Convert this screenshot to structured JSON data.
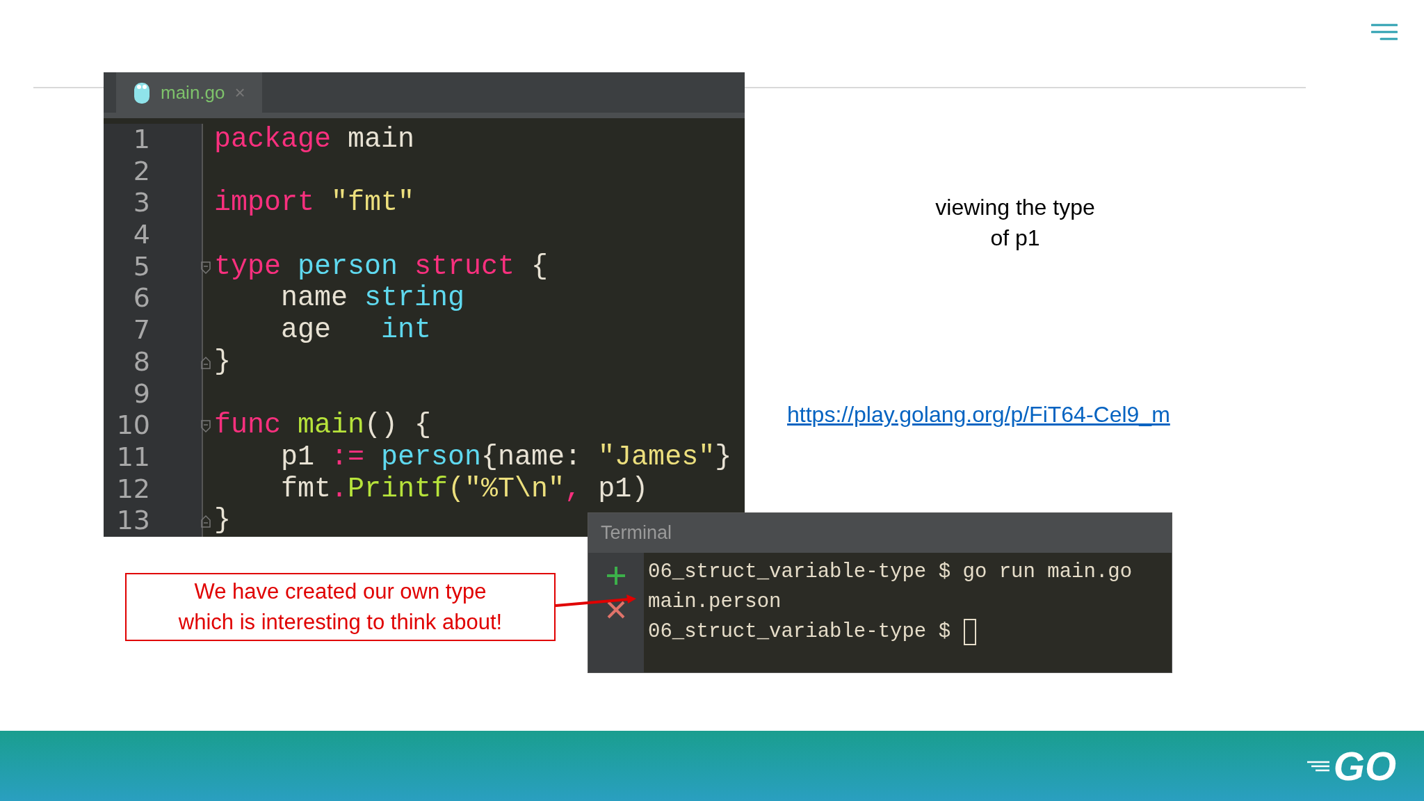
{
  "editor": {
    "tab": {
      "label": "main.go",
      "close": "×",
      "selected": true
    },
    "lines": [
      {
        "number": "1",
        "kind": "plain",
        "tokens": [
          {
            "text": "package",
            "kind": "keyword"
          },
          {
            "text": " main",
            "kind": "plain"
          }
        ]
      },
      {
        "number": "2",
        "kind": "plain"
      },
      {
        "number": "3",
        "kind": "plain",
        "tokens": [
          {
            "text": "import",
            "kind": "keyword"
          },
          {
            "text": " \"fmt\"",
            "kind": "string"
          }
        ]
      },
      {
        "number": "4",
        "kind": "plain"
      },
      {
        "number": "5",
        "kind": "fold-start",
        "tokens": [
          {
            "text": "type",
            "kind": "keyword"
          },
          {
            "text": " person",
            "kind": "type"
          },
          {
            "text": " struct",
            "kind": "keyword"
          },
          {
            "text": " {",
            "kind": "plain"
          }
        ]
      },
      {
        "number": "6",
        "kind": "plain",
        "tokens": [
          {
            "text": "    name",
            "kind": "plain"
          },
          {
            "text": " string",
            "kind": "type"
          }
        ]
      },
      {
        "number": "7",
        "kind": "plain",
        "tokens": [
          {
            "text": "    age",
            "kind": "plain"
          },
          {
            "text": "   int",
            "kind": "type"
          }
        ]
      },
      {
        "number": "8",
        "kind": "fold-end",
        "tokens": [
          {
            "text": "}",
            "kind": "plain"
          }
        ]
      },
      {
        "number": "9",
        "kind": "plain"
      },
      {
        "number": "10",
        "kind": "fold-start",
        "tokens": [
          {
            "text": "func",
            "kind": "keyword"
          },
          {
            "text": " main",
            "kind": "func"
          },
          {
            "text": "() {",
            "kind": "plain"
          }
        ]
      },
      {
        "number": "11",
        "kind": "plain",
        "tokens": [
          {
            "text": "    p1 ",
            "kind": "plain"
          },
          {
            "text": ":=",
            "kind": "keyword"
          },
          {
            "text": " person",
            "kind": "type"
          },
          {
            "text": "{name: ",
            "kind": "plain"
          },
          {
            "text": "\"James\"",
            "kind": "string"
          },
          {
            "text": "}",
            "kind": "plain"
          }
        ]
      },
      {
        "number": "12",
        "kind": "plain",
        "tokens": [
          {
            "text": "    fmt",
            "kind": "plain"
          },
          {
            "text": ".",
            "kind": "keyword"
          },
          {
            "text": "Printf",
            "kind": "func"
          },
          {
            "text": "(\"%T\\n\"",
            "kind": "string"
          },
          {
            "text": ",",
            "kind": "keyword"
          },
          {
            "text": " p1)",
            "kind": "plain"
          }
        ]
      },
      {
        "number": "13",
        "kind": "fold-end",
        "tokens": [
          {
            "text": "}",
            "kind": "plain"
          }
        ]
      }
    ]
  },
  "note": {
    "lines": [
      "viewing the type",
      "of p1"
    ]
  },
  "link": "https://play.golang.org/p/FiT64-Cel9_m",
  "terminal": {
    "title": "Terminal",
    "lines": [
      {
        "text": "06_struct_variable-type $ go run main.go",
        "cursor": false
      },
      {
        "text": "main.person",
        "cursor": false
      },
      {
        "text": "06_struct_variable-type $ ",
        "cursor": true
      }
    ]
  },
  "callout": {
    "lines": [
      "We have created our own type",
      "which is interesting to think about!"
    ]
  },
  "footer": {
    "logo": "GO"
  }
}
